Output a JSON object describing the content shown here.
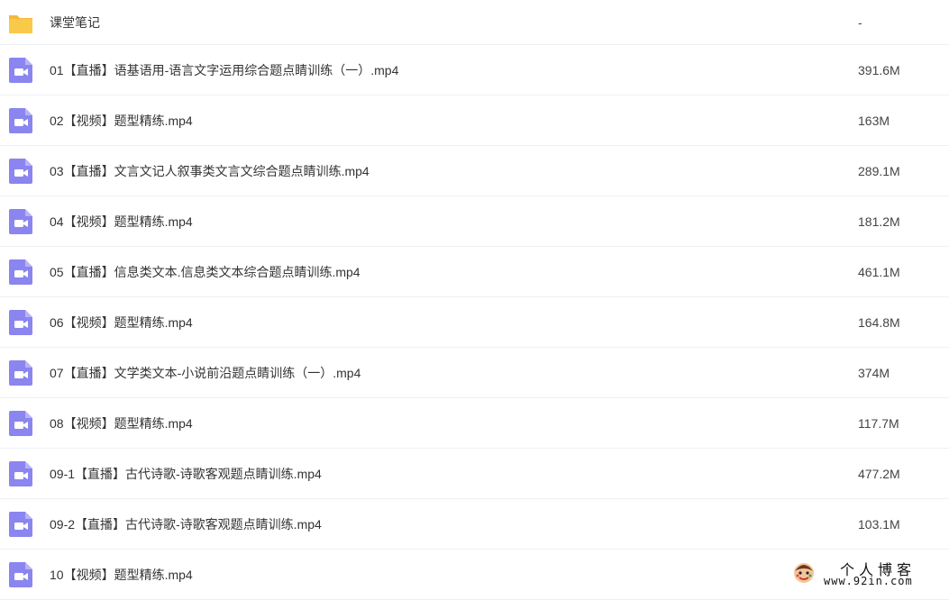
{
  "files": [
    {
      "name": "课堂笔记",
      "size": "-",
      "icon": "folder-icon"
    },
    {
      "name": "01【直播】语基语用-语言文字运用综合题点睛训练（一）.mp4",
      "size": "391.6M",
      "icon": "video-file-icon"
    },
    {
      "name": "02【视频】题型精练.mp4",
      "size": "163M",
      "icon": "video-file-icon"
    },
    {
      "name": "03【直播】文言文记人叙事类文言文综合题点睛训练.mp4",
      "size": "289.1M",
      "icon": "video-file-icon"
    },
    {
      "name": "04【视频】题型精练.mp4",
      "size": "181.2M",
      "icon": "video-file-icon"
    },
    {
      "name": "05【直播】信息类文本.信息类文本综合题点睛训练.mp4",
      "size": "461.1M",
      "icon": "video-file-icon"
    },
    {
      "name": "06【视频】题型精练.mp4",
      "size": "164.8M",
      "icon": "video-file-icon"
    },
    {
      "name": "07【直播】文学类文本-小说前沿题点睛训练（一）.mp4",
      "size": "374M",
      "icon": "video-file-icon"
    },
    {
      "name": "08【视频】题型精练.mp4",
      "size": "117.7M",
      "icon": "video-file-icon"
    },
    {
      "name": "09-1【直播】古代诗歌-诗歌客观题点睛训练.mp4",
      "size": "477.2M",
      "icon": "video-file-icon"
    },
    {
      "name": "09-2【直播】古代诗歌-诗歌客观题点睛训练.mp4",
      "size": "103.1M",
      "icon": "video-file-icon"
    },
    {
      "name": "10【视频】题型精练.mp4",
      "size": "",
      "icon": "video-file-icon"
    }
  ],
  "watermark": {
    "title": "个人博客",
    "url": "www.92in.com"
  },
  "colors": {
    "folder": "#f9c94a",
    "video": "#8b85ef",
    "divider": "#eef0f4"
  }
}
